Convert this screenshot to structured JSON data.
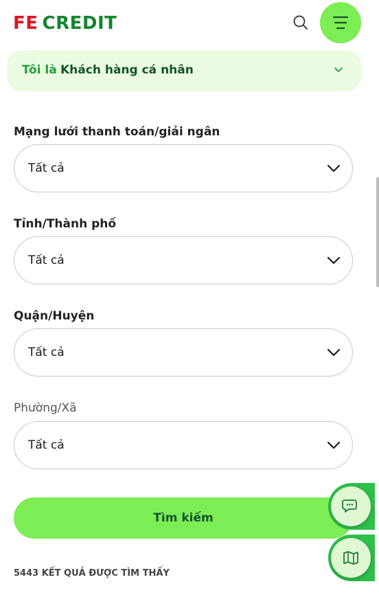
{
  "header": {
    "logo_fe": "FE",
    "logo_credit": "CREDIT",
    "search_icon": "search-icon",
    "menu_icon": "menu-icon"
  },
  "customer_type": {
    "label": "Tôi là",
    "value": "Khách hàng cá nhân"
  },
  "filters": [
    {
      "label": "Mạng lưới thanh toán/giải ngân",
      "value": "Tất cả"
    },
    {
      "label": "Tỉnh/Thành phố",
      "value": "Tất cả"
    },
    {
      "label": "Quận/Huyện",
      "value": "Tất cả"
    },
    {
      "label": "Phường/Xã",
      "value": "Tất cả"
    }
  ],
  "search_button": "Tìm kiếm",
  "result_count": "5443 KẾT QUẢ ĐƯỢC TÌM THẤY",
  "floating": {
    "chat_icon": "chat-icon",
    "map_icon": "map-icon"
  },
  "colors": {
    "brand_red": "#e0141e",
    "brand_green": "#14862e",
    "accent_green": "#7ded55",
    "light_green_bg": "#ebfbe1"
  }
}
